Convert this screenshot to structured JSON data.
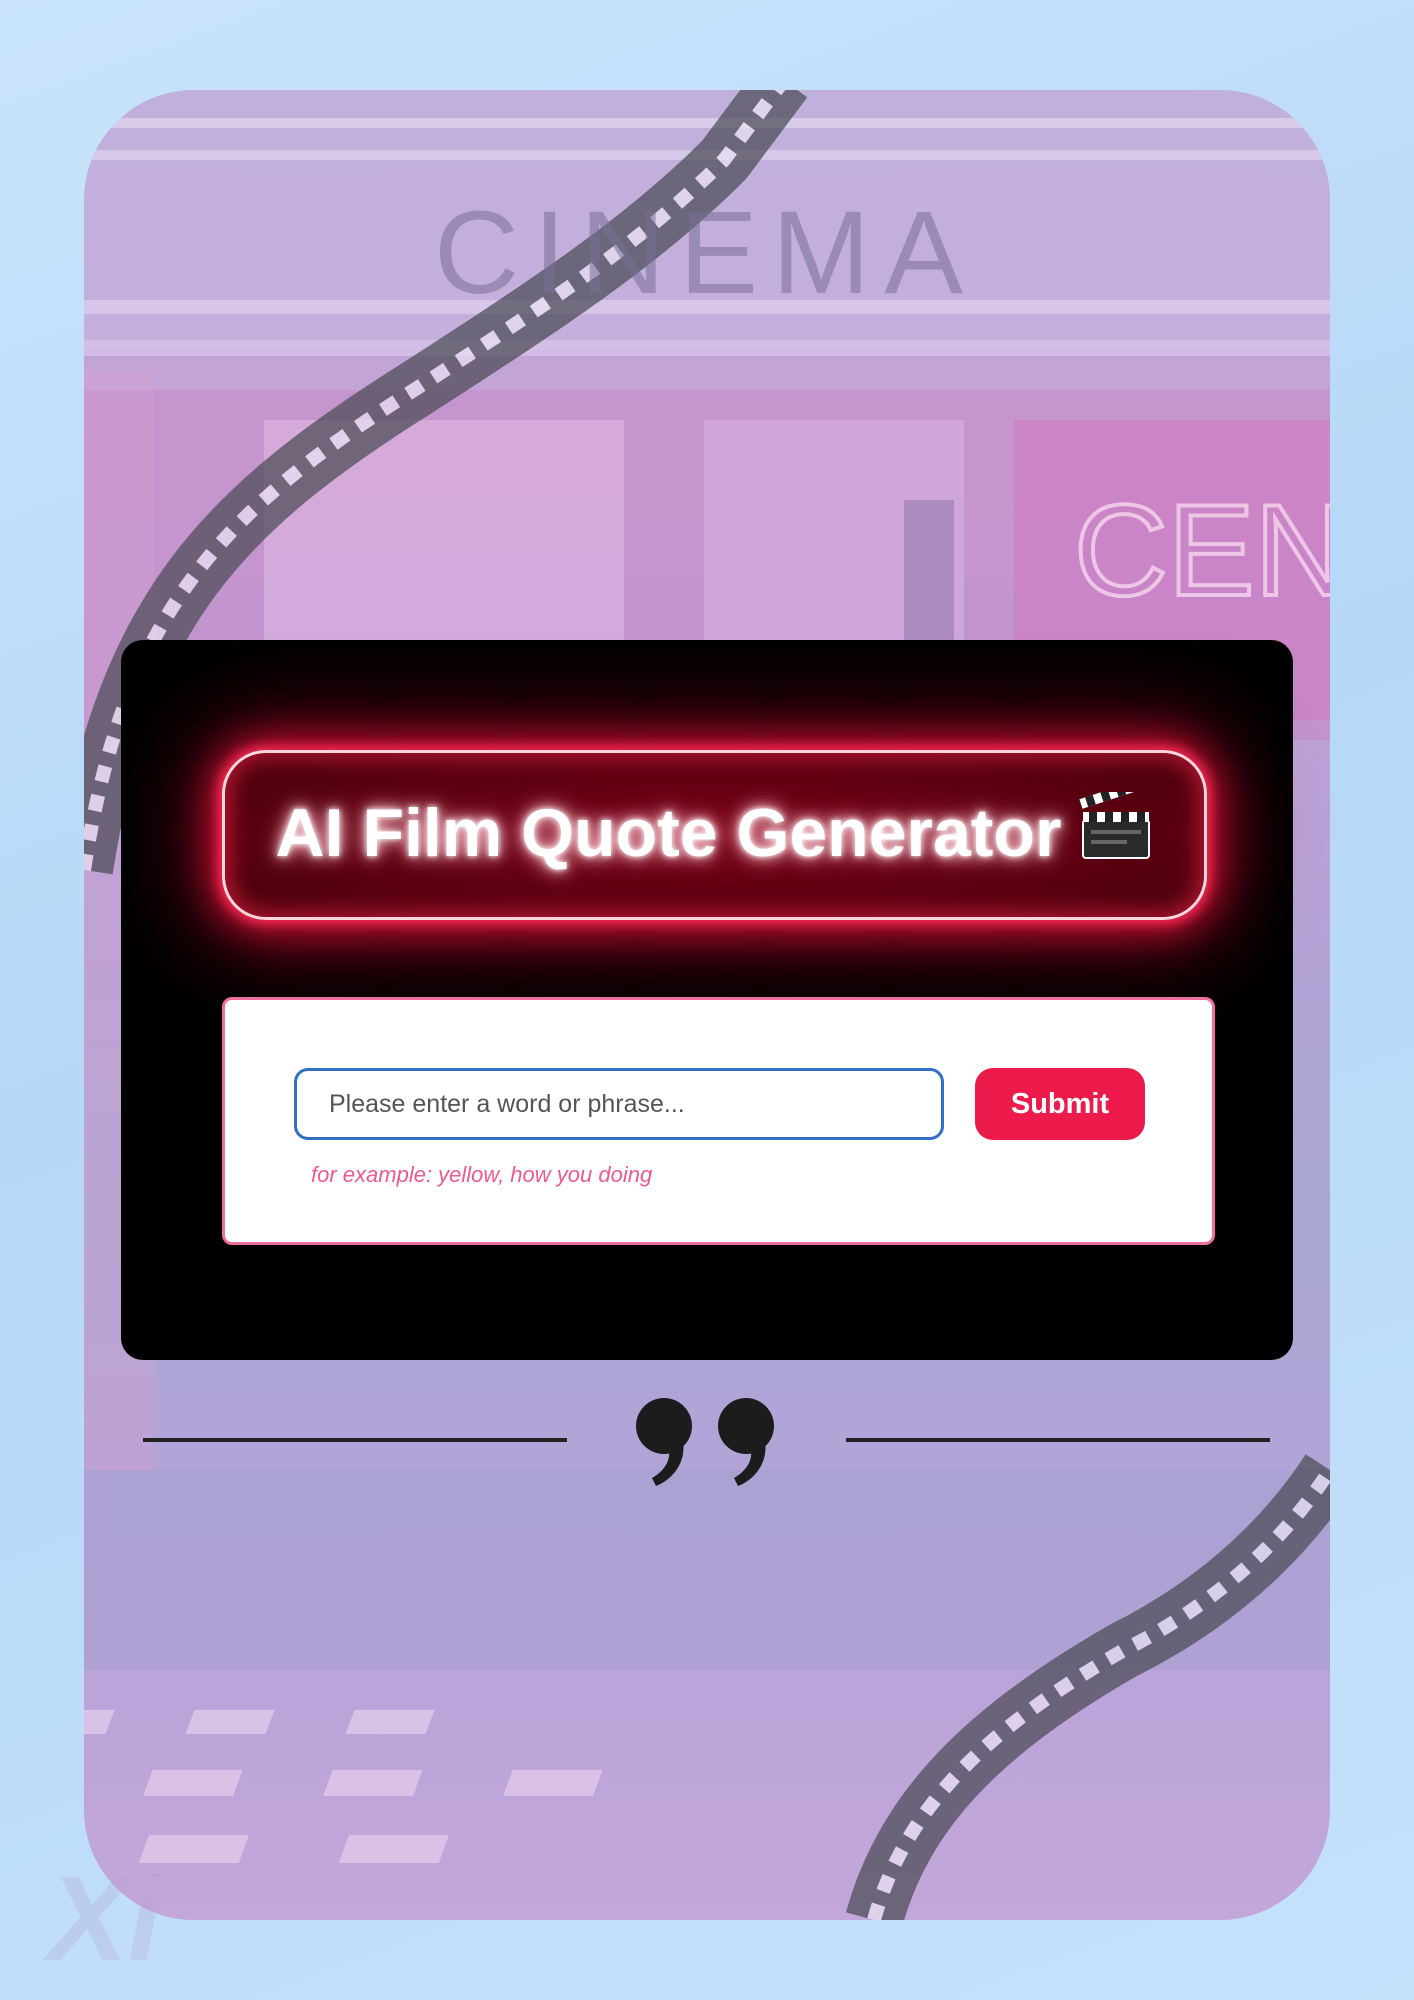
{
  "scene": {
    "marquee_text": "CINEMA",
    "neon_sign_text": "CEN"
  },
  "header": {
    "title": "AI Film Quote Generator",
    "icon": "clapperboard-icon"
  },
  "form": {
    "input_placeholder": "Please enter a word or phrase...",
    "input_value": "",
    "submit_label": "Submit",
    "hint": "for example: yellow, how you doing"
  },
  "quote_divider": {
    "icon": "quote-mark-icon"
  },
  "watermark": "Xi",
  "colors": {
    "page_bg": "#c2def9",
    "panel_bg": "#000000",
    "neon_red": "#ec1b4c",
    "hint_pink": "#ec5b8a",
    "input_border": "#2f6fc6"
  }
}
